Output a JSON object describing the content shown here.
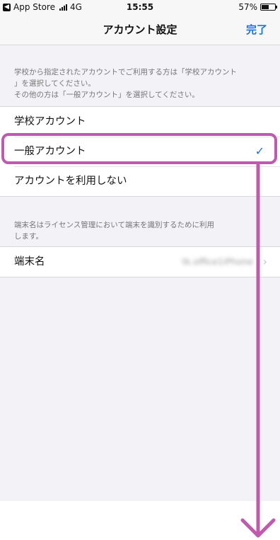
{
  "status_bar": {
    "carrier": "App Store",
    "network": "4G",
    "time": "15:55",
    "battery_percent": "57%",
    "battery_level": 0.57
  },
  "nav": {
    "title": "アカウント設定",
    "done_label": "完了"
  },
  "account_section": {
    "header_line1": "学校から指定されたアカウントでご利用する方は「学校アカウント",
    "header_line2": "」を選択してください。",
    "header_line3": "その他の方は「一般アカウント」を選択してください。",
    "options": [
      {
        "label": "学校アカウント"
      },
      {
        "label": "一般アカウント",
        "selected": true
      },
      {
        "label": "アカウントを利用しない"
      }
    ]
  },
  "device_section": {
    "header_line1": "端末名はライセンス管理において端末を識別するために利用",
    "header_line2": "します。",
    "row_label": "端末名",
    "row_value": "tk.office1iPhone"
  },
  "colors": {
    "accent": "#1c73e8",
    "annotation": "#c05aae"
  },
  "icons": {
    "check": "checkmark-icon",
    "chevron": "chevron-right-icon"
  }
}
